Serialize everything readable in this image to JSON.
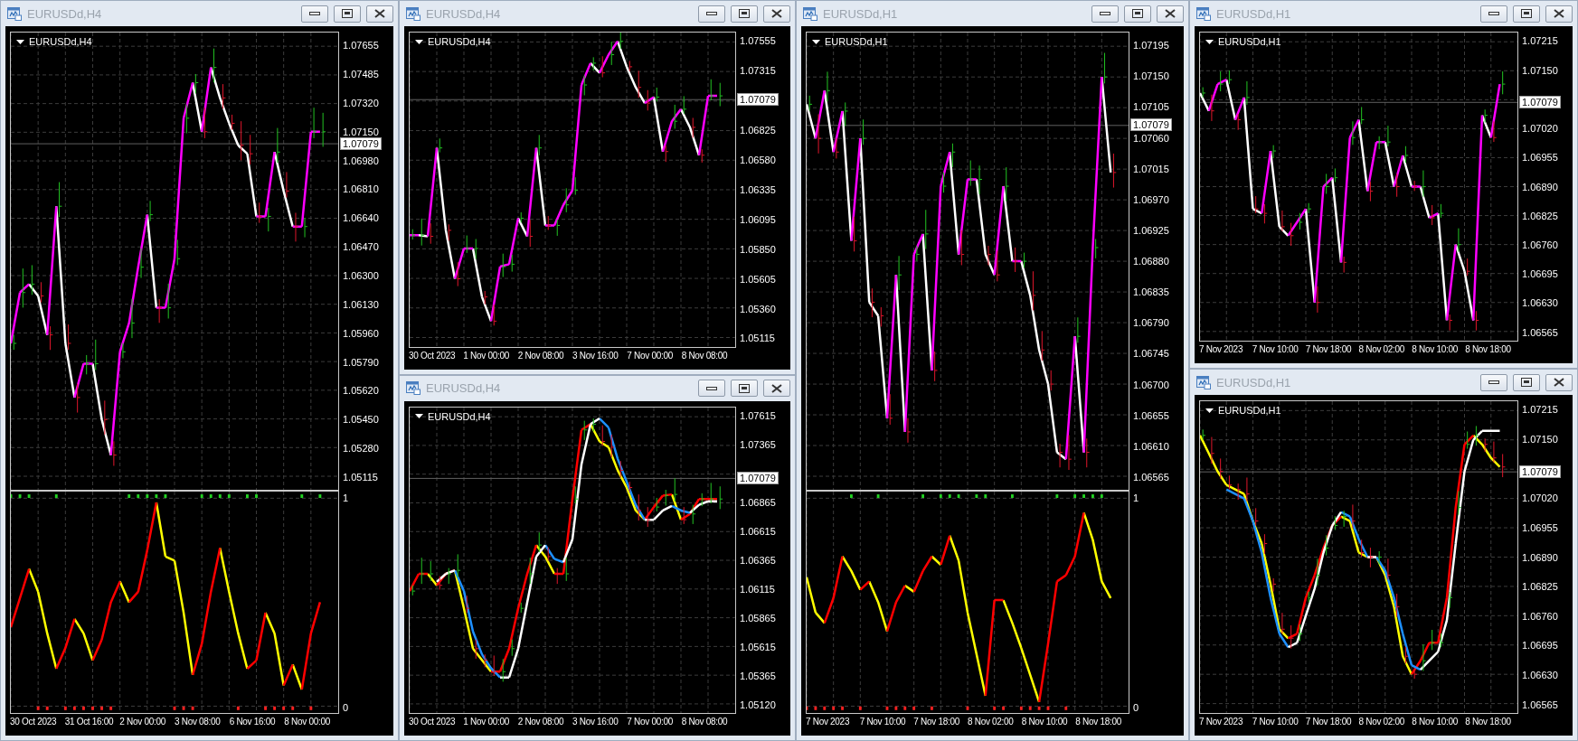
{
  "windows": [
    {
      "title": "EURUSDd,H4",
      "chart_label": "EURUSDd,H4",
      "panes": [
        {
          "price_scale": [
            "1.07655",
            "1.07485",
            "1.07320",
            "1.07150",
            "1.06980",
            "1.06810",
            "1.06640",
            "1.06470",
            "1.06300",
            "1.06130",
            "1.05960",
            "1.05790",
            "1.05620",
            "1.05450",
            "1.05280",
            "1.05115"
          ],
          "current_price": "1.07079"
        },
        {
          "price_scale": [
            "1",
            "0"
          ]
        }
      ],
      "time_scale": [
        "30 Oct 2023",
        "31 Oct 16:00",
        "2 Nov 00:00",
        "3 Nov 08:00",
        "6 Nov 16:00",
        "8 Nov 00:00"
      ]
    },
    {
      "title": "EURUSDd,H4",
      "chart_label": "EURUSDd,H4",
      "panes": [
        {
          "price_scale": [
            "1.07555",
            "1.07315",
            "1.06825",
            "1.06580",
            "1.06335",
            "1.06095",
            "1.05850",
            "1.05605",
            "1.05360",
            "1.05115"
          ],
          "current_price": "1.07079"
        }
      ],
      "time_scale": [
        "30 Oct 2023",
        "1 Nov 00:00",
        "2 Nov 08:00",
        "3 Nov 16:00",
        "7 Nov 00:00",
        "8 Nov 08:00"
      ]
    },
    {
      "title": "EURUSDd,H4",
      "chart_label": "EURUSDd,H4",
      "panes": [
        {
          "price_scale": [
            "1.07615",
            "1.07365",
            "1.06865",
            "1.06615",
            "1.06365",
            "1.06115",
            "1.05865",
            "1.05615",
            "1.05365",
            "1.05120"
          ],
          "current_price": "1.07079"
        }
      ],
      "time_scale": [
        "30 Oct 2023",
        "1 Nov 00:00",
        "2 Nov 08:00",
        "3 Nov 16:00",
        "7 Nov 00:00",
        "8 Nov 08:00"
      ]
    },
    {
      "title": "EURUSDd,H1",
      "chart_label": "EURUSDd,H1",
      "panes": [
        {
          "price_scale": [
            "1.07195",
            "1.07150",
            "1.07105",
            "1.07060",
            "1.07015",
            "1.06970",
            "1.06925",
            "1.06880",
            "1.06835",
            "1.06790",
            "1.06745",
            "1.06700",
            "1.06655",
            "1.06610",
            "1.06565"
          ],
          "current_price": "1.07079"
        },
        {
          "price_scale": [
            "1",
            "0"
          ]
        }
      ],
      "time_scale": [
        "7 Nov 2023",
        "7 Nov 10:00",
        "7 Nov 18:00",
        "8 Nov 02:00",
        "8 Nov 10:00",
        "8 Nov 18:00"
      ]
    },
    {
      "title": "EURUSDd,H1",
      "chart_label": "EURUSDd,H1",
      "panes": [
        {
          "price_scale": [
            "1.07215",
            "1.07150",
            "1.07020",
            "1.06955",
            "1.06890",
            "1.06825",
            "1.06760",
            "1.06695",
            "1.06630",
            "1.06565"
          ],
          "current_price": "1.07079"
        }
      ],
      "time_scale": [
        "7 Nov 2023",
        "7 Nov 10:00",
        "7 Nov 18:00",
        "8 Nov 02:00",
        "8 Nov 10:00",
        "8 Nov 18:00"
      ]
    },
    {
      "title": "EURUSDd,H1",
      "chart_label": "EURUSDd,H1",
      "panes": [
        {
          "price_scale": [
            "1.07215",
            "1.07150",
            "1.07020",
            "1.06955",
            "1.06890",
            "1.06825",
            "1.06760",
            "1.06695",
            "1.06630",
            "1.06565"
          ],
          "current_price": "1.07079"
        }
      ],
      "time_scale": [
        "7 Nov 2023",
        "7 Nov 10:00",
        "7 Nov 18:00",
        "8 Nov 02:00",
        "8 Nov 10:00",
        "8 Nov 18:00"
      ]
    }
  ]
}
